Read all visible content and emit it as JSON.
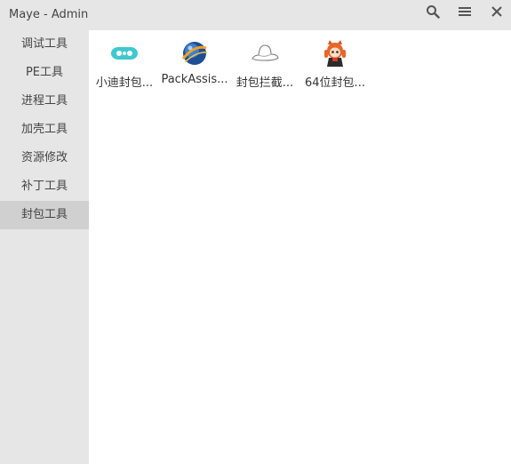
{
  "window": {
    "title": "Maye - Admin"
  },
  "titlebar": {
    "buttons": [
      {
        "icon": "search-icon"
      },
      {
        "icon": "hamburger-menu-icon"
      },
      {
        "icon": "close-icon"
      }
    ]
  },
  "sidebar": {
    "items": [
      {
        "label": "调试工具",
        "active": false
      },
      {
        "label": "PE工具",
        "active": false
      },
      {
        "label": "进程工具",
        "active": false
      },
      {
        "label": "加壳工具",
        "active": false
      },
      {
        "label": "资源修改",
        "active": false
      },
      {
        "label": "补丁工具",
        "active": false
      },
      {
        "label": "封包工具",
        "active": true
      }
    ]
  },
  "content": {
    "tiles": [
      {
        "label": "小迪封包...",
        "icon": "cyan-link-icon"
      },
      {
        "label": "PackAssis...",
        "icon": "globe-orb-icon"
      },
      {
        "label": "封包拦截...",
        "icon": "white-hat-icon"
      },
      {
        "label": "64位封包...",
        "icon": "anime-character-icon"
      }
    ]
  },
  "colors": {
    "chrome": "#e6e6e6",
    "active_item": "#d0d0d0",
    "content_bg": "#ffffff",
    "accent_cyan": "#3ec8cf"
  }
}
